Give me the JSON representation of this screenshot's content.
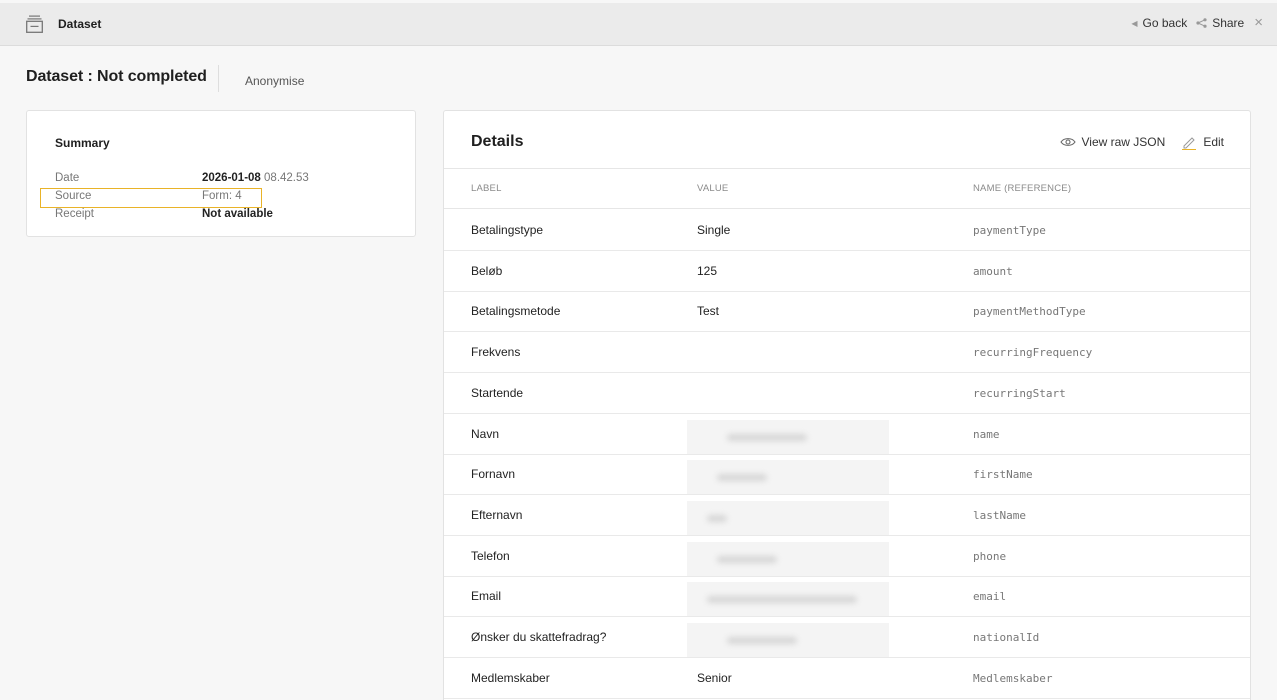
{
  "topbar": {
    "title": "Dataset",
    "go_back": "Go back",
    "share": "Share",
    "close": "×"
  },
  "header": {
    "title": "Dataset : Not completed",
    "anonymise": "Anonymise"
  },
  "summary": {
    "title": "Summary",
    "rows": [
      {
        "key": "Date",
        "value_date": "2026-01-08",
        "value_time": "08.42.53"
      },
      {
        "key": "Source",
        "value": "Form: 4"
      },
      {
        "key": "Receipt",
        "value": "Not available"
      }
    ]
  },
  "details": {
    "title": "Details",
    "view_raw_json": "View raw JSON",
    "edit": "Edit",
    "columns": [
      "LABEL",
      "VALUE",
      "NAME (REFERENCE)"
    ],
    "rows": [
      {
        "label": "Betalingstype",
        "value": "Single",
        "ref": "paymentType"
      },
      {
        "label": "Beløb",
        "value": "125",
        "ref": "amount"
      },
      {
        "label": "Betalingsmetode",
        "value": "Test",
        "ref": "paymentMethodType"
      },
      {
        "label": "Frekvens",
        "value": "",
        "ref": "recurringFrequency"
      },
      {
        "label": "Startende",
        "value": "",
        "ref": "recurringStart"
      },
      {
        "label": "Navn",
        "value": "",
        "ref": "name"
      },
      {
        "label": "Fornavn",
        "value": "",
        "ref": "firstName"
      },
      {
        "label": "Efternavn",
        "value": "",
        "ref": "lastName"
      },
      {
        "label": "Telefon",
        "value": "",
        "ref": "phone"
      },
      {
        "label": "Email",
        "value": "",
        "ref": "email"
      },
      {
        "label": "Ønsker du skattefradrag?",
        "value": "",
        "ref": "nationalId"
      },
      {
        "label": "Medlemskaber",
        "value": "Senior",
        "ref": "Medlemskaber"
      }
    ]
  },
  "colors": {
    "highlight": "#e9b328",
    "topbar_bg": "#ebebeb",
    "page_bg": "#f7f7f7"
  }
}
